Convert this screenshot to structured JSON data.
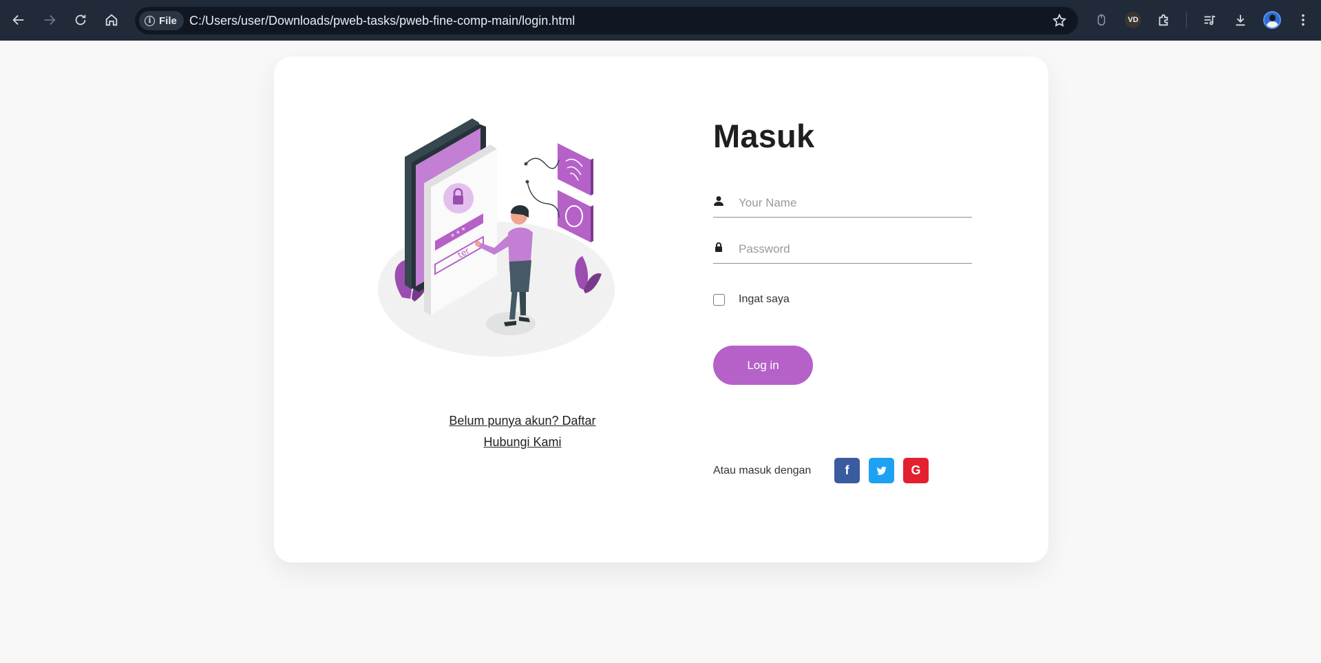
{
  "browser": {
    "chip_label": "File",
    "url": "C:/Users/user/Downloads/pweb-tasks/pweb-fine-comp-main/login.html",
    "extension_label": "VD"
  },
  "login": {
    "title": "Masuk",
    "name_placeholder": "Your Name",
    "password_placeholder": "Password",
    "remember_label": "Ingat saya",
    "login_button": "Log in",
    "social_text": "Atau masuk dengan",
    "register_link": "Belum punya akun? Daftar",
    "contact_link": "Hubungi Kami"
  },
  "social": [
    {
      "name": "facebook",
      "glyph": "f",
      "color": "#3b5ba0"
    },
    {
      "name": "twitter",
      "glyph": "twitter-bird",
      "color": "#1da1f2"
    },
    {
      "name": "google",
      "glyph": "G",
      "color": "#e3202f"
    }
  ],
  "colors": {
    "accent": "#b561c8",
    "chrome_bg": "#202a38",
    "page_bg": "#f8f8f8"
  }
}
